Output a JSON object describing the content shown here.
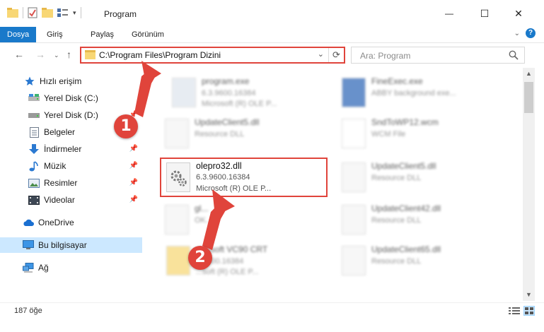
{
  "window": {
    "title": "Program",
    "minimize_glyph": "—",
    "maximize_glyph": "☐",
    "close_glyph": "✕"
  },
  "ribbon": {
    "tabs": [
      "Dosya",
      "Giriş",
      "Paylaş",
      "Görünüm"
    ],
    "accent_color": "#1979ca"
  },
  "address": {
    "path": "C:\\Program Files\\Program Dizini",
    "search_placeholder": "Ara: Program"
  },
  "sidebar": {
    "items": [
      {
        "label": "Hızlı erişim",
        "icon": "star-icon"
      },
      {
        "label": "Yerel Disk (C:)",
        "icon": "drive-icon"
      },
      {
        "label": "Yerel Disk (D:)",
        "icon": "drive-icon"
      },
      {
        "label": "Belgeler",
        "icon": "documents-icon"
      },
      {
        "label": "İndirmeler",
        "icon": "download-icon"
      },
      {
        "label": "Müzik",
        "icon": "music-icon"
      },
      {
        "label": "Resimler",
        "icon": "pictures-icon"
      },
      {
        "label": "Videolar",
        "icon": "video-icon"
      },
      {
        "label": "OneDrive",
        "icon": "cloud-icon"
      },
      {
        "label": "Bu bilgisayar",
        "icon": "computer-icon"
      },
      {
        "label": "Ağ",
        "icon": "network-icon"
      }
    ]
  },
  "files": [
    {
      "name": "program.exe",
      "line1": "6.3.9600.16384",
      "line2": "Microsoft (R) OLE P..."
    },
    {
      "name": "FineExec.exe",
      "line1": "ABBY background exe...",
      "line2": ""
    },
    {
      "name": "UpdateClient5.dll",
      "line1": "Resource DLL",
      "line2": ""
    },
    {
      "name": "SndToWP12.wcm",
      "line1": "WCM File",
      "line2": ""
    },
    {
      "name": "olepro32.dll",
      "line1": "6.3.9600.16384",
      "line2": "Microsoft (R) OLE P..."
    },
    {
      "name": "UpdateClient5.dll",
      "line1": "Resource DLL",
      "line2": ""
    },
    {
      "name": "gl...",
      "line1": "OK...",
      "line2": ""
    },
    {
      "name": "UpdateClient42.dll",
      "line1": "Resource DLL",
      "line2": ""
    },
    {
      "name": "...rosoft VC90 CRT",
      "line1": "...9600.16384",
      "line2": "...soft (R) OLE P..."
    },
    {
      "name": "UpdateClient65.dll",
      "line1": "Resource DLL",
      "line2": ""
    }
  ],
  "status": {
    "count": "187 öğe"
  },
  "annotations": {
    "step1": "1",
    "step2": "2",
    "color": "#e0443b"
  }
}
